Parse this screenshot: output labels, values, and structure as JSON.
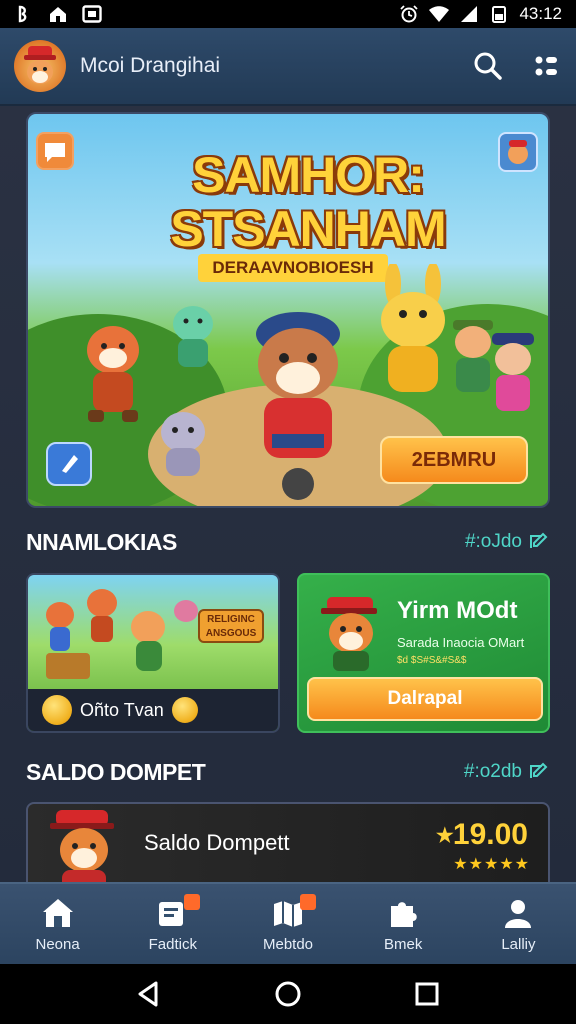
{
  "status_bar": {
    "time": "43:12"
  },
  "app_bar": {
    "title": "Mcoi Drangihai"
  },
  "hero": {
    "title": "SAMHOR: STSANHAM",
    "subtitle": "DERAAVNOBIOESH",
    "cta_label": "2EBMRU"
  },
  "section_1": {
    "title": "NNAMLOKIAS",
    "link_label": "#:oJdo"
  },
  "card_left": {
    "sign_text": "RELIGINC ANSGOUS",
    "footer_label": "Oñto Tvan"
  },
  "card_right": {
    "title": "Yirm MOdt",
    "line1": "Sarada Inaocia OMart",
    "line2": "$d $S#S&#S&$",
    "button_label": "Dalrapal"
  },
  "section_2": {
    "title": "SALDO DOMPET",
    "link_label": "#:o2db"
  },
  "wallet": {
    "label": "Saldo Dompett",
    "amount": "⭑19.00",
    "stars": "★★★★★"
  },
  "bottom_nav": {
    "items": [
      {
        "label": "Neona",
        "icon": "home-icon"
      },
      {
        "label": "Fadtick",
        "icon": "inbox-icon"
      },
      {
        "label": "Mebtdo",
        "icon": "map-icon"
      },
      {
        "label": "Bmek",
        "icon": "puzzle-icon"
      },
      {
        "label": "Lalliy",
        "icon": "user-icon"
      }
    ]
  },
  "colors": {
    "accent_link": "#4fd6c8",
    "cta_orange": "#f58a1c",
    "card_green": "#35b04a",
    "gold": "#ffd23a"
  }
}
